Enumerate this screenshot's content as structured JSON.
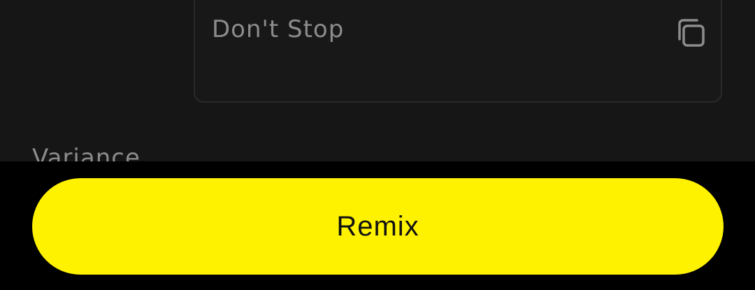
{
  "prompt_box": {
    "value": "Don't Stop",
    "copy_icon": "copy-icon"
  },
  "variance": {
    "label": "Variance"
  },
  "actions": {
    "remix_label": "Remix"
  },
  "colors": {
    "background": "#161616",
    "bottom_bar": "#000000",
    "accent": "#fff200",
    "muted_text": "#8c8c8c"
  }
}
